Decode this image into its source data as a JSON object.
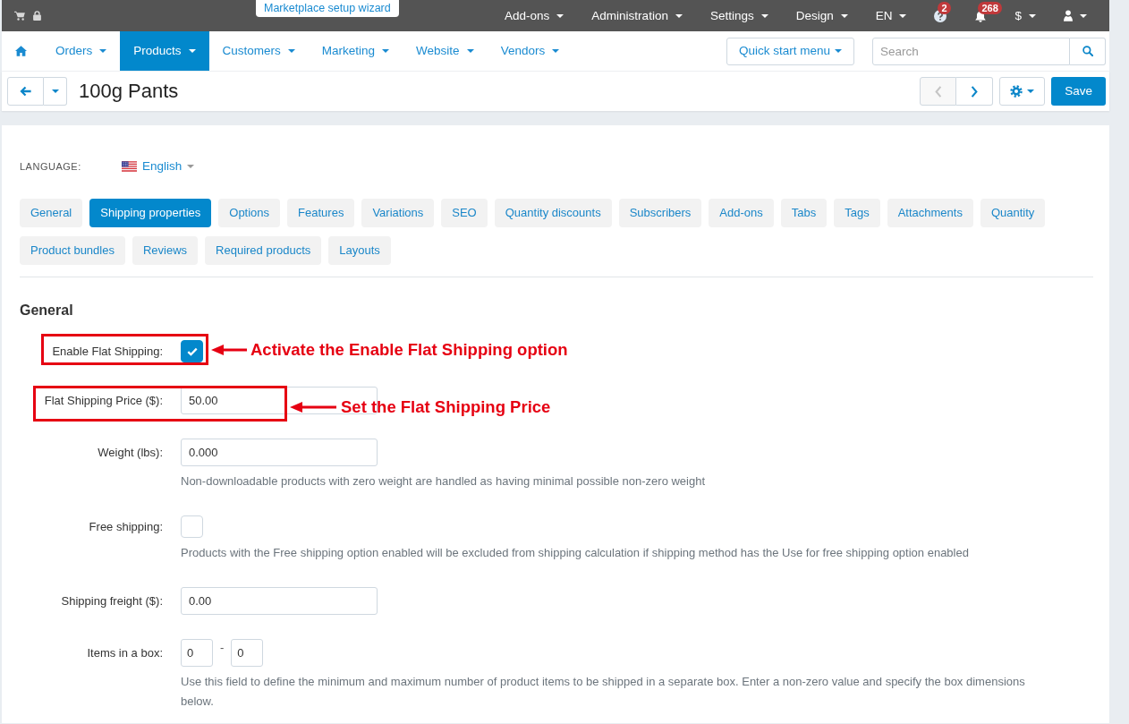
{
  "top_bar": {
    "wizard_button": "Marketplace setup wizard",
    "menus": [
      {
        "kind": "text",
        "label": "Add-ons"
      },
      {
        "kind": "text",
        "label": "Administration"
      },
      {
        "kind": "text",
        "label": "Settings"
      },
      {
        "kind": "text",
        "label": "Design"
      },
      {
        "kind": "text",
        "label": "EN"
      },
      {
        "kind": "help",
        "badge": "2"
      },
      {
        "kind": "bell",
        "badge": "268"
      },
      {
        "kind": "text",
        "label": "$"
      },
      {
        "kind": "user"
      }
    ]
  },
  "main_nav": {
    "items": [
      {
        "label": "Orders",
        "selected": false
      },
      {
        "label": "Products",
        "selected": true
      },
      {
        "label": "Customers",
        "selected": false
      },
      {
        "label": "Marketing",
        "selected": false
      },
      {
        "label": "Website",
        "selected": false
      },
      {
        "label": "Vendors",
        "selected": false
      }
    ],
    "quick_start_button": "Quick start menu",
    "search": {
      "placeholder": "Search"
    }
  },
  "toolbar": {
    "title": "100g Pants",
    "previous_disabled": true,
    "next_disabled": false,
    "save_button": "Save"
  },
  "language": {
    "label": "LANGUAGE:",
    "value": "English"
  },
  "tabs": [
    {
      "label": "General",
      "selected": false
    },
    {
      "label": "Shipping properties",
      "selected": true
    },
    {
      "label": "Options",
      "selected": false
    },
    {
      "label": "Features",
      "selected": false
    },
    {
      "label": "Variations",
      "selected": false
    },
    {
      "label": "SEO",
      "selected": false
    },
    {
      "label": "Quantity discounts",
      "selected": false
    },
    {
      "label": "Subscribers",
      "selected": false
    },
    {
      "label": "Add-ons",
      "selected": false
    },
    {
      "label": "Tabs",
      "selected": false
    },
    {
      "label": "Tags",
      "selected": false
    },
    {
      "label": "Attachments",
      "selected": false
    },
    {
      "label": "Quantity",
      "selected": false
    },
    {
      "label": "Product bundles",
      "selected": false
    },
    {
      "label": "Reviews",
      "selected": false
    },
    {
      "label": "Required products",
      "selected": false
    },
    {
      "label": "Layouts",
      "selected": false
    }
  ],
  "section_title": "General",
  "fields": [
    {
      "kind": "checkbox",
      "label": "Enable Flat Shipping:",
      "checked": true,
      "annotation": "Activate the Enable Flat Shipping option"
    },
    {
      "kind": "input",
      "label": "Flat Shipping Price ($):",
      "value": "50.00",
      "annotation": "Set the Flat Shipping Price"
    },
    {
      "kind": "input",
      "label": "Weight (lbs):",
      "value": "0.000",
      "help": "Non-downloadable products with zero weight are handled as having minimal possible non-zero weight"
    },
    {
      "kind": "checkbox",
      "label": "Free shipping:",
      "checked": false,
      "help": "Products with the Free shipping option enabled will be excluded from shipping calculation if shipping method has the Use for free shipping option enabled"
    },
    {
      "kind": "input",
      "label": "Shipping freight ($):",
      "value": "0.00"
    },
    {
      "kind": "range",
      "label": "Items in a box:",
      "values": [
        "0",
        "0"
      ],
      "separator": "-",
      "help": "Use this field to define the minimum and maximum number of product items to be shipped in a separate box. Enter a non-zero value and specify the box dimensions below."
    }
  ]
}
